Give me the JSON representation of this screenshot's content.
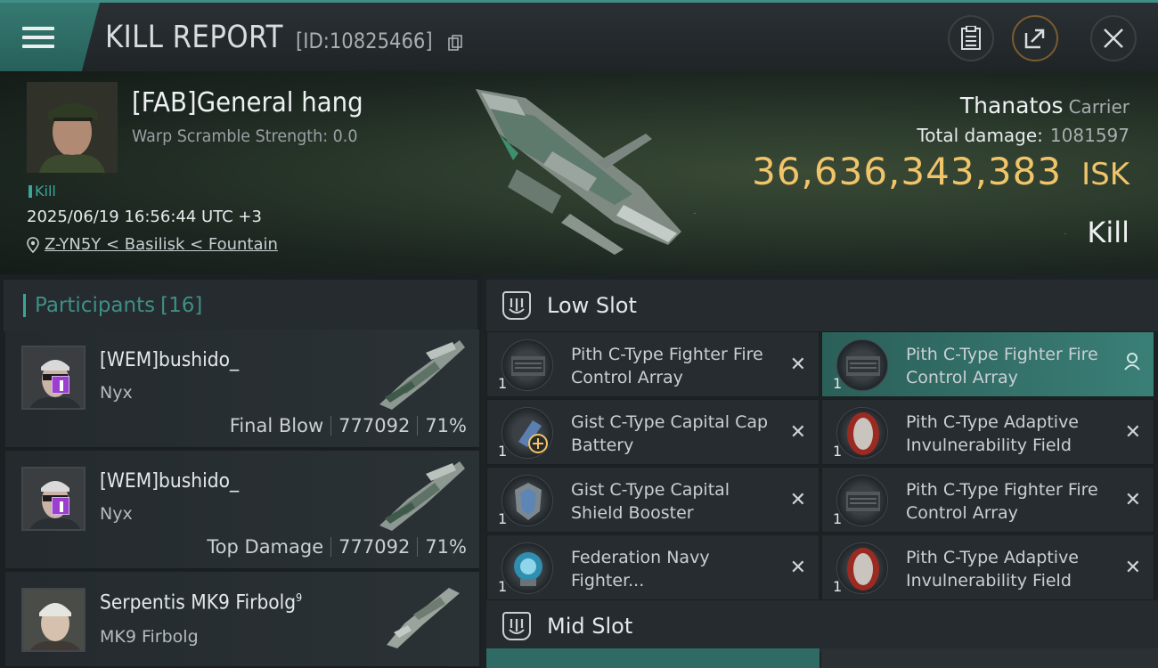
{
  "header": {
    "title": "KILL REPORT",
    "report_id": "[ID:10825466]"
  },
  "victim": {
    "name": "[FAB]General hang",
    "warp_scramble": "Warp Scramble Strength: 0.0",
    "kill_tag": "Kill",
    "datetime": "2025/06/19 16:56:44 UTC +3",
    "location": "Z-YN5Y < Basilisk < Fountain",
    "ship": "Thanatos",
    "ship_class": "Carrier",
    "total_damage_label": "Total damage:",
    "total_damage": "1081597",
    "isk_value": "36,636,343,383",
    "isk_unit": "ISK",
    "result": "Kill"
  },
  "participants": {
    "label": "Participants",
    "count": "[16]",
    "rows": [
      {
        "name": "[WEM]bushido_",
        "ship": "Nyx",
        "role": "Final Blow",
        "damage": "777092",
        "percent": "71%"
      },
      {
        "name": "[WEM]bushido_",
        "ship": "Nyx",
        "role": "Top Damage",
        "damage": "777092",
        "percent": "71%"
      },
      {
        "name": "Serpentis MK9 Firbolg",
        "sup": "9",
        "ship": "MK9 Firbolg"
      }
    ]
  },
  "fittings": {
    "low_slot_label": "Low Slot",
    "mid_slot_label": "Mid Slot",
    "low_slot": [
      {
        "name": "Pith C-Type Fighter Fire Control Array",
        "qty": "1",
        "status": "destroyed"
      },
      {
        "name": "Pith C-Type Fighter Fire Control Array",
        "qty": "1",
        "status": "dropped"
      },
      {
        "name": "Gist C-Type Capital Cap Battery",
        "qty": "1",
        "status": "destroyed"
      },
      {
        "name": "Pith C-Type Adaptive Invulnerability Field",
        "qty": "1",
        "status": "destroyed"
      },
      {
        "name": "Gist C-Type Capital Shield Booster",
        "qty": "1",
        "status": "destroyed"
      },
      {
        "name": "Pith C-Type Fighter Fire Control Array",
        "qty": "1",
        "status": "destroyed"
      },
      {
        "name": "Federation Navy Fighter...",
        "qty": "1",
        "status": "destroyed"
      },
      {
        "name": "Pith C-Type Adaptive Invulnerability Field",
        "qty": "1",
        "status": "destroyed"
      }
    ]
  },
  "colors": {
    "accent": "#3aa69a",
    "isk_gold": "#f0c469",
    "highlight_row": "#3a7f77"
  }
}
